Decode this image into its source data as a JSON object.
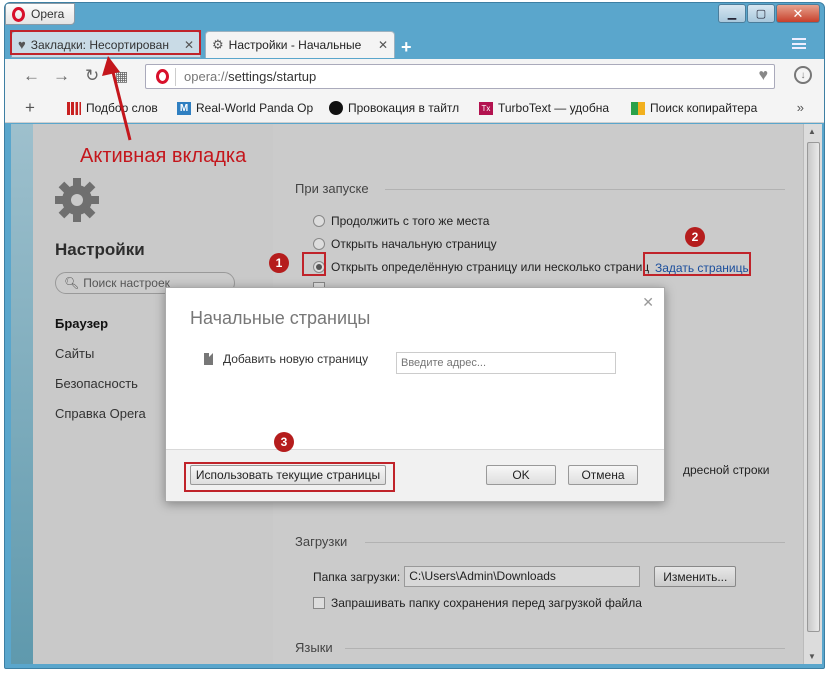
{
  "app": {
    "menu_label": "Opera"
  },
  "window_controls": {
    "minimize": "▁",
    "maximize": "▢",
    "close": "✕"
  },
  "tabs": [
    {
      "title": "Закладки: Несортирован",
      "close": "✕"
    },
    {
      "title": "Настройки - Начальные",
      "close": "✕"
    }
  ],
  "toolbar": {
    "url_scheme": "opera://",
    "url_path": "settings/startup"
  },
  "bookmarks": [
    {
      "label": "Подбор слов",
      "color": "#c82020"
    },
    {
      "label": "Real-World Panda Op",
      "color": "#2f7fc1"
    },
    {
      "label": "Провокация в тайтл",
      "color": "#111111"
    },
    {
      "label": "TurboText — удобна",
      "color": "#b3124f"
    },
    {
      "label": "Поиск копирайтера",
      "color": "#2aa14a"
    }
  ],
  "sidebar": {
    "title": "Настройки",
    "search_placeholder": "Поиск настроек",
    "items": [
      "Браузер",
      "Сайты",
      "Безопасность",
      "Справка Opera"
    ]
  },
  "startup": {
    "heading": "При запуске",
    "options": [
      "Продолжить с того же места",
      "Открыть начальную страницу",
      "Открыть определённую страницу или несколько страниц"
    ],
    "set_pages_link": "Задать страницы",
    "address_bar_tail": "дресной строки"
  },
  "downloads": {
    "heading": "Загрузки",
    "folder_label": "Папка загрузки:",
    "folder_value": "C:\\Users\\Admin\\Downloads",
    "change_button": "Изменить...",
    "ask_checkbox": "Запрашивать папку сохранения перед загрузкой файла"
  },
  "languages": {
    "heading": "Языки"
  },
  "dialog": {
    "title": "Начальные страницы",
    "add_label": "Добавить новую страницу",
    "address_placeholder": "Введите адрес...",
    "use_current_button": "Использовать текущие страницы",
    "ok_button": "OK",
    "cancel_button": "Отмена"
  },
  "annotations": {
    "active_tab_caption": "Активная вкладка",
    "badges": [
      "1",
      "2",
      "3"
    ],
    "accent_color": "#c0232a"
  }
}
